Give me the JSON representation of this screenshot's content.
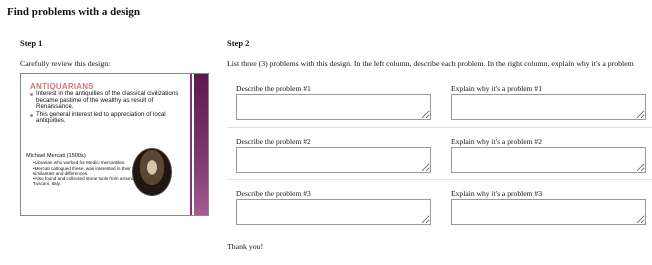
{
  "page_title": "Find problems with a design",
  "step1": {
    "title": "Step 1",
    "description": "Carefully review this design:",
    "slide": {
      "heading": "ANTIQUARIANS",
      "bullets": [
        "Interest in the antiquities of the classical civilizations became pastime of the wealthy as result of Renaissance.",
        "This general interest led to appreciation of local antiquities."
      ],
      "person": "Michael Mercati (1500s)",
      "sub_bullets": [
        "•Librarian who worked for Medici mercantiles.",
        "•Mercati catlogued these, was interested in their similarities and differences.",
        "•Also found and collected stone tools from around Tuscani, Italy."
      ]
    }
  },
  "step2": {
    "title": "Step 2",
    "description": "List three (3) problems with this design. In the left column, describe each problem. In the right column, explain why it's a problem",
    "rows": [
      {
        "describe_label": "Describe the problem #1",
        "explain_label": "Explain why it's a problem #1",
        "describe_value": "",
        "explain_value": ""
      },
      {
        "describe_label": "Describe the problem #2",
        "explain_label": "Explain why it's a problem #2",
        "describe_value": "",
        "explain_value": ""
      },
      {
        "describe_label": "Describe the problem #3",
        "explain_label": "Explain why it's a problem #3",
        "describe_value": "",
        "explain_value": ""
      }
    ]
  },
  "footer": "Thank you!"
}
